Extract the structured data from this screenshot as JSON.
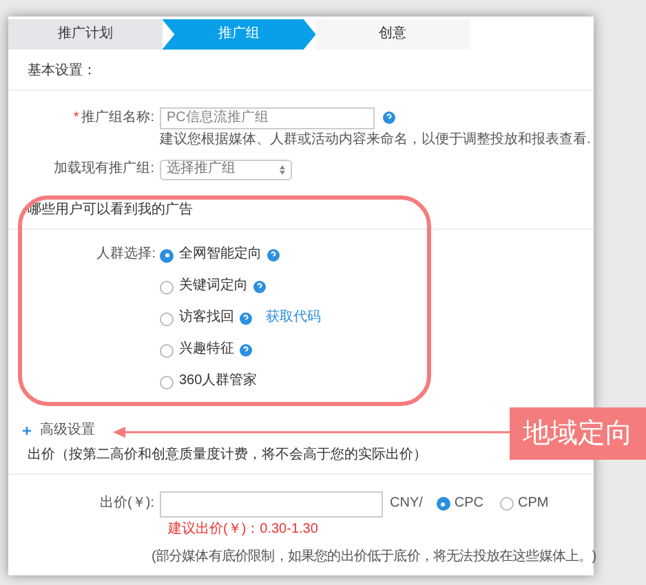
{
  "steps": [
    {
      "label": "推广计划",
      "selected": false
    },
    {
      "label": "推广组",
      "selected": true
    },
    {
      "label": "创意",
      "selected": false
    }
  ],
  "basic": {
    "title": "基本设置：",
    "name_field": {
      "required_mark": "*",
      "label": "推广组名称:",
      "placeholder": "PC信息流推广组",
      "hint": "建议您根据媒体、人群或活动内容来命名，以便于调整投放和报表查看."
    },
    "load_field": {
      "label": "加载现有推广组:",
      "value": "选择推广组"
    }
  },
  "audience": {
    "title": "哪些用户可以看到我的广告",
    "label": "人群选择:",
    "options": [
      {
        "label": "全网智能定向",
        "selected": true,
        "help": true
      },
      {
        "label": "关键词定向",
        "selected": false,
        "help": true
      },
      {
        "label": "访客找回",
        "selected": false,
        "help": true,
        "link": "获取代码"
      },
      {
        "label": "兴趣特征",
        "selected": false,
        "help": true
      },
      {
        "label": "360人群管家",
        "selected": false,
        "help": false
      }
    ]
  },
  "advanced": {
    "icon": "+",
    "label": "高级设置"
  },
  "bid": {
    "title": "出价（按第二高价和创意质量度计费，将不会高于您的实际出价）",
    "label": "出价(￥):",
    "unit": "CNY/",
    "modes": [
      {
        "label": "CPC",
        "selected": true
      },
      {
        "label": "CPM",
        "selected": false
      }
    ],
    "suggestion": "建议出价(￥)：0.30-1.30",
    "note": "(部分媒体有底价限制，如果您的出价低于底价，将无法投放在这些媒体上。)"
  },
  "annotation": {
    "label": "地域定向"
  }
}
